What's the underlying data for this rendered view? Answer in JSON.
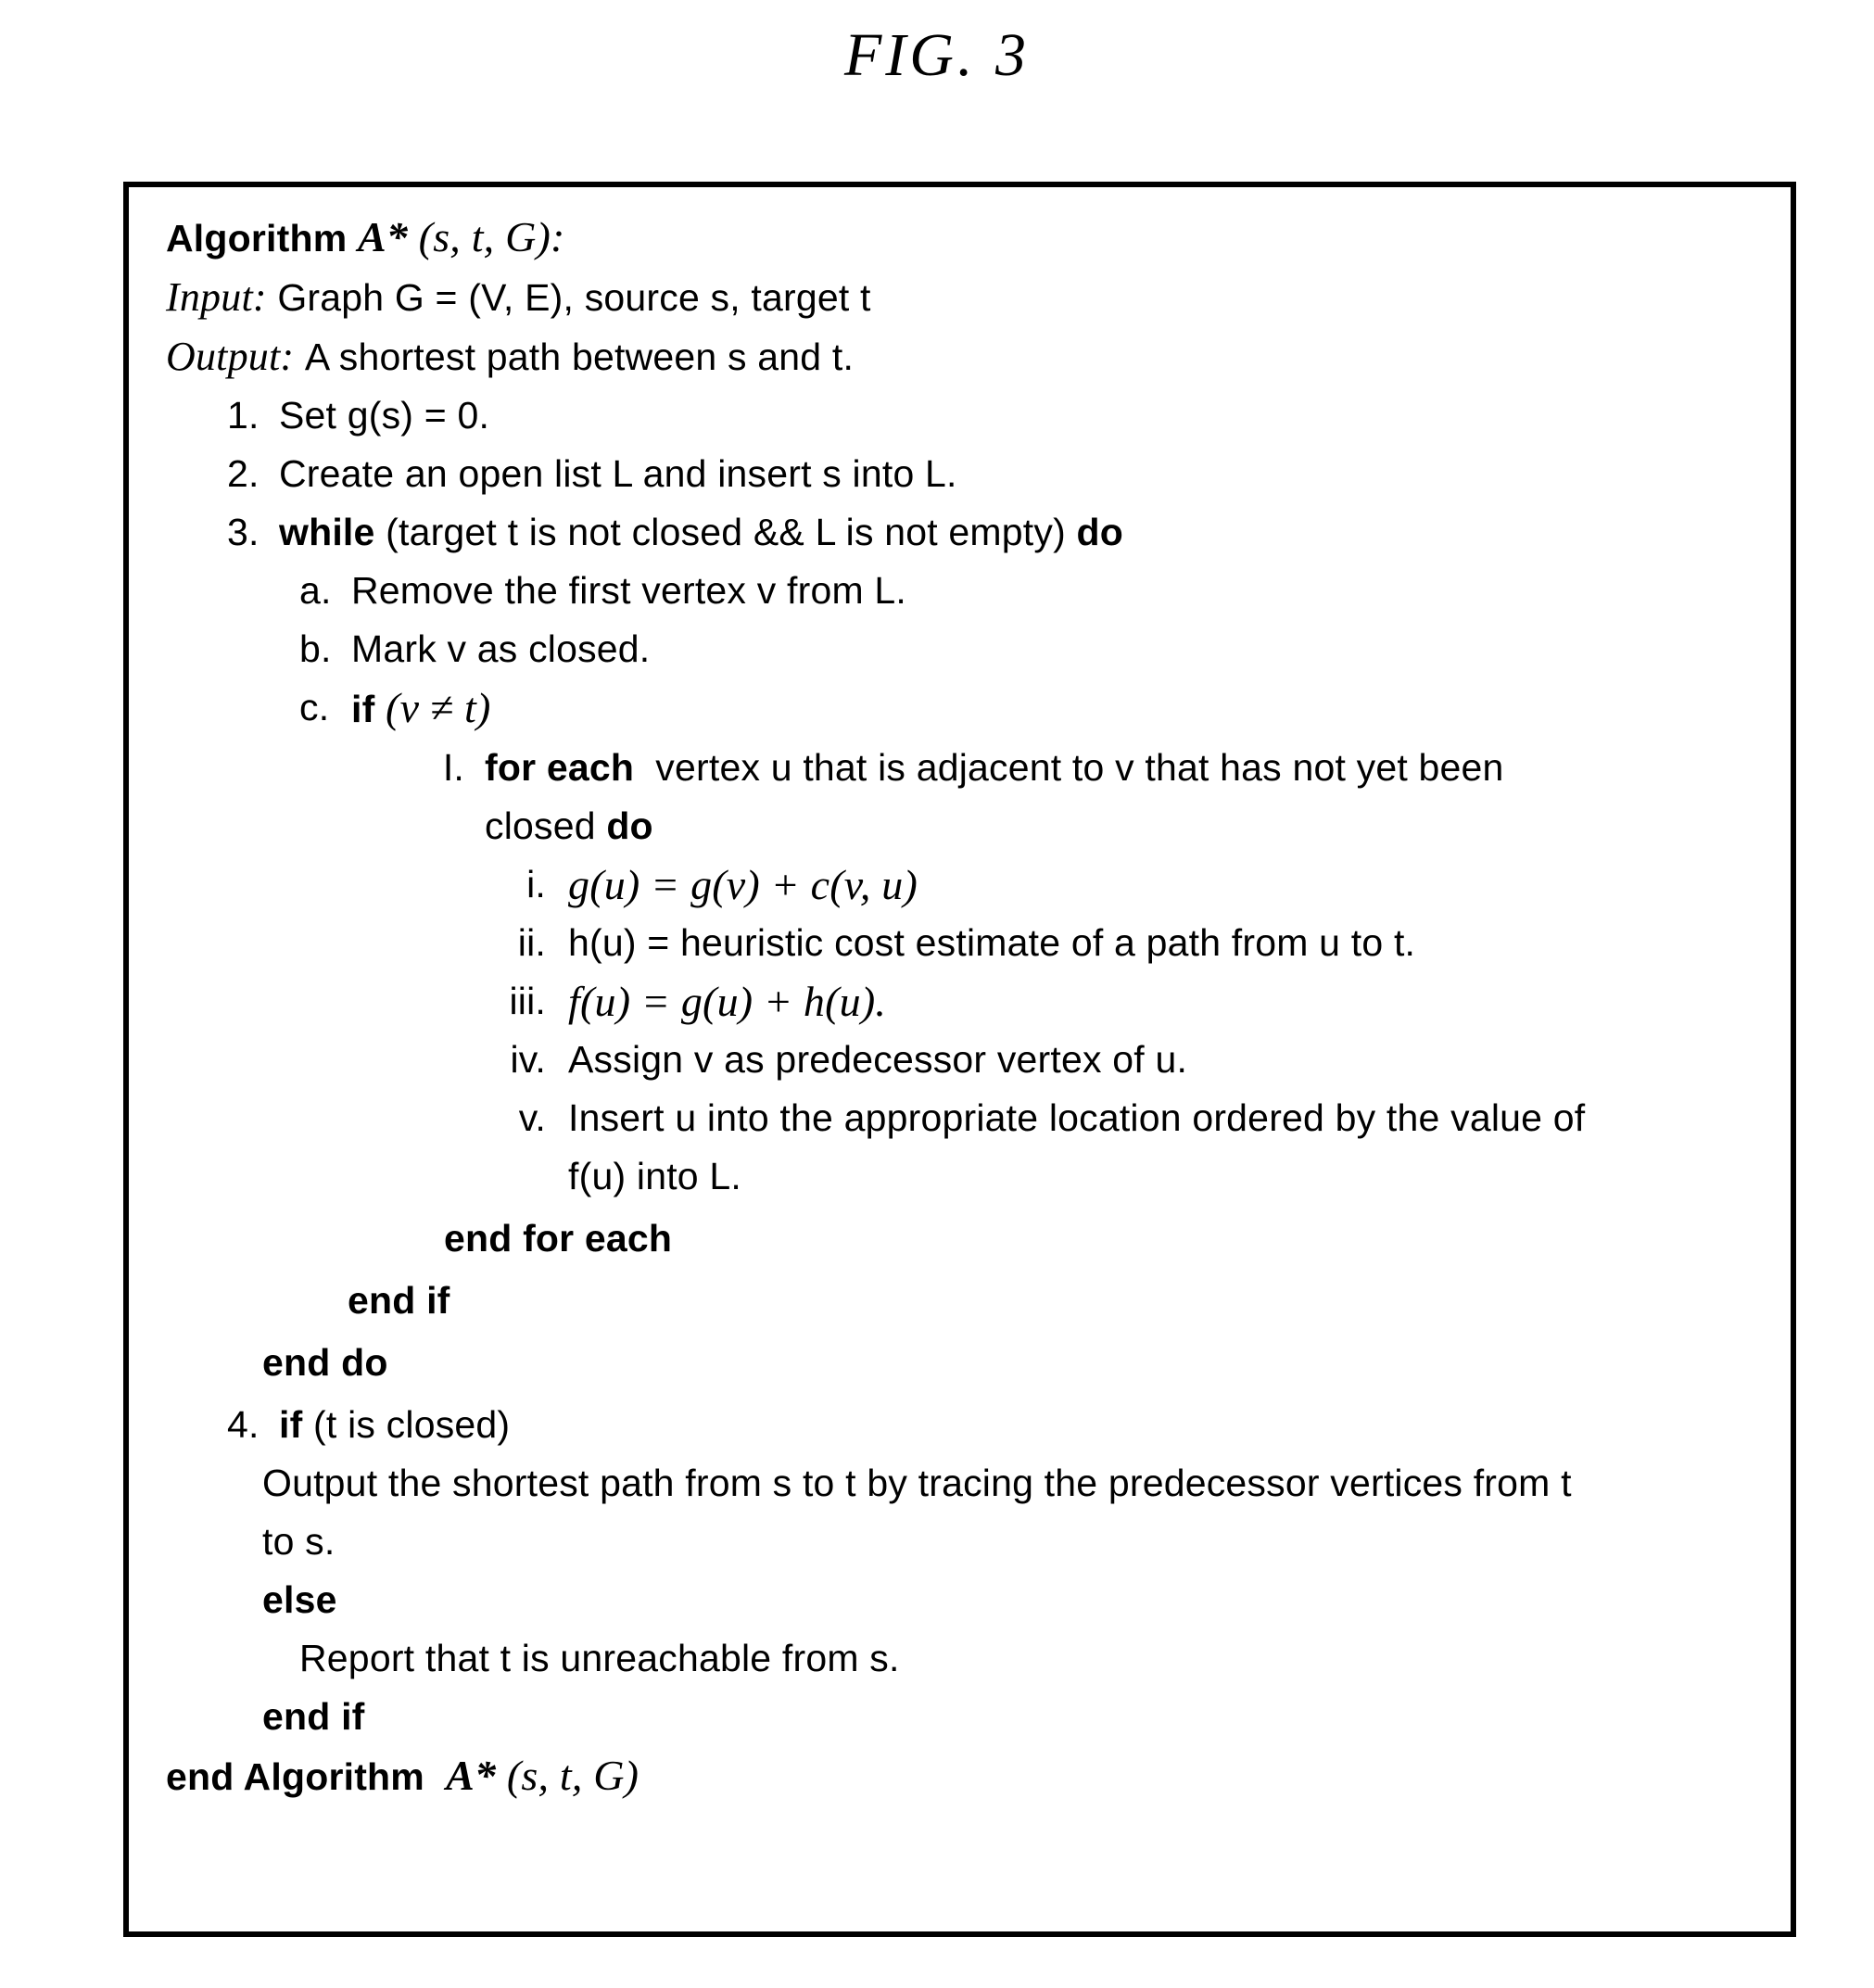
{
  "figure": {
    "title": "FIG.  3"
  },
  "algorithm": {
    "header": {
      "title_keyword": "Algorithm",
      "title_name": "A*",
      "title_args": "(s,  t,  G):",
      "input_label": "Input:",
      "input_text": "Graph G  =  (V, E),  source s,  target t",
      "output_label": "Output:",
      "output_text": "A  shortest  path  between s  and t."
    },
    "steps": [
      {
        "marker": "1.",
        "text": "Set g(s)  =  0."
      },
      {
        "marker": "2.",
        "text": "Create  an  open  list L and  insert s  into L."
      },
      {
        "marker": "3.",
        "keyword": "while",
        "text": "(target t  is  not  closed && L is  not  empty)",
        "tail_keyword": "do",
        "substeps": [
          {
            "marker": "a.",
            "text": "Remove  the  first  vertex v from L."
          },
          {
            "marker": "b.",
            "text": "Mark v as  closed."
          },
          {
            "marker": "c.",
            "keyword": "if",
            "text": "(v ≠ t)",
            "substeps": [
              {
                "marker": "I.",
                "keyword": "for each",
                "text": "vertex u that  is  adjacent  to v that  has  not  yet  been  closed",
                "tail_keyword": "do",
                "substeps": [
                  {
                    "marker": "i.",
                    "text": "g(u)  =  g(v)  +  c(v,  u)"
                  },
                  {
                    "marker": "ii.",
                    "text": "h(u)  =  heuristic  cost  estimate  of  a  path  from u to t."
                  },
                  {
                    "marker": "iii.",
                    "text": "f(u)  =  g(u)  +  h(u)."
                  },
                  {
                    "marker": "iv.",
                    "text": "Assign v as  predecessor  vertex  of u."
                  },
                  {
                    "marker": "v.",
                    "text": "Insert u into  the  appropriate  location  ordered  by  the  value  of f(u) into L."
                  }
                ],
                "end_keyword": "end for each"
              }
            ],
            "end_keyword": "end if"
          }
        ],
        "end_keyword": "end do"
      },
      {
        "marker": "4.",
        "keyword": "if",
        "text": "(t  is  closed)",
        "then_text": "Output  the  shortest  path  from s  to t by  tracing  the  predecessor  vertices  from t to s.",
        "else_keyword": "else",
        "else_text": "Report  that t is  unreachable  from s.",
        "end_keyword": "end if"
      }
    ],
    "footer": {
      "end_keyword": "end Algorithm",
      "name": "A*",
      "args": "(s,  t,  G)"
    }
  }
}
